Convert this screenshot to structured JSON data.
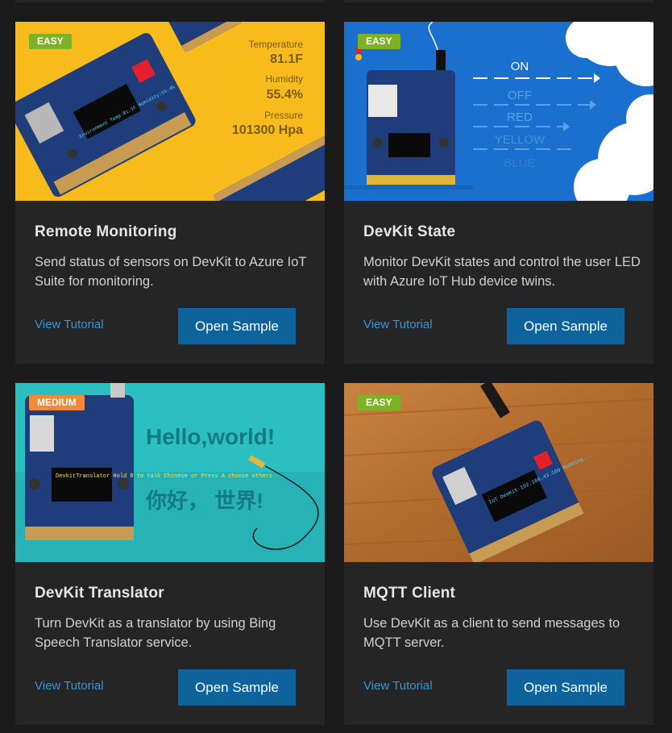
{
  "cards": [
    {
      "difficulty": "EASY",
      "title": "Remote Monitoring",
      "description": "Send status of sensors on DevKit to Azure IoT Suite for monitoring.",
      "tutorial_link": "View Tutorial",
      "open_button": "Open Sample",
      "image": {
        "background": "#f8bb1c",
        "labels": [
          "Temperature",
          "Humidity",
          "Pressure"
        ],
        "values": [
          "81.1F",
          "55.4%",
          "101300 Hpa"
        ],
        "screen_text": "Environment Temp:81.1F Humidity:55.4%"
      }
    },
    {
      "difficulty": "EASY",
      "title": "DevKit State",
      "description": "Monitor DevKit states and control the user LED with Azure IoT Hub device twins.",
      "tutorial_link": "View Tutorial",
      "open_button": "Open Sample",
      "image": {
        "background": "#1a6fcf",
        "states": [
          "ON",
          "OFF",
          "RED",
          "YELLOW",
          "BLUE"
        ]
      }
    },
    {
      "difficulty": "MEDIUM",
      "title": "DevKit Translator",
      "description": "Turn DevKit as a translator by using Bing Speech Translator service.",
      "tutorial_link": "View Tutorial",
      "open_button": "Open Sample",
      "image": {
        "background": "#2bbfc2",
        "headline": "Hello,world!",
        "headline_cn": "你好， 世界!",
        "screen_text": "DevkitTranslator Hold B to talk Chinese or Press A choose others"
      }
    },
    {
      "difficulty": "EASY",
      "title": "MQTT Client",
      "description": "Use DevKit as a client to send messages to MQTT server.",
      "tutorial_link": "View Tutorial",
      "open_button": "Open Sample",
      "image": {
        "background": "#b06a2c",
        "screen_text": "IoT DevKit 192.168.43.160 Running..."
      }
    }
  ]
}
